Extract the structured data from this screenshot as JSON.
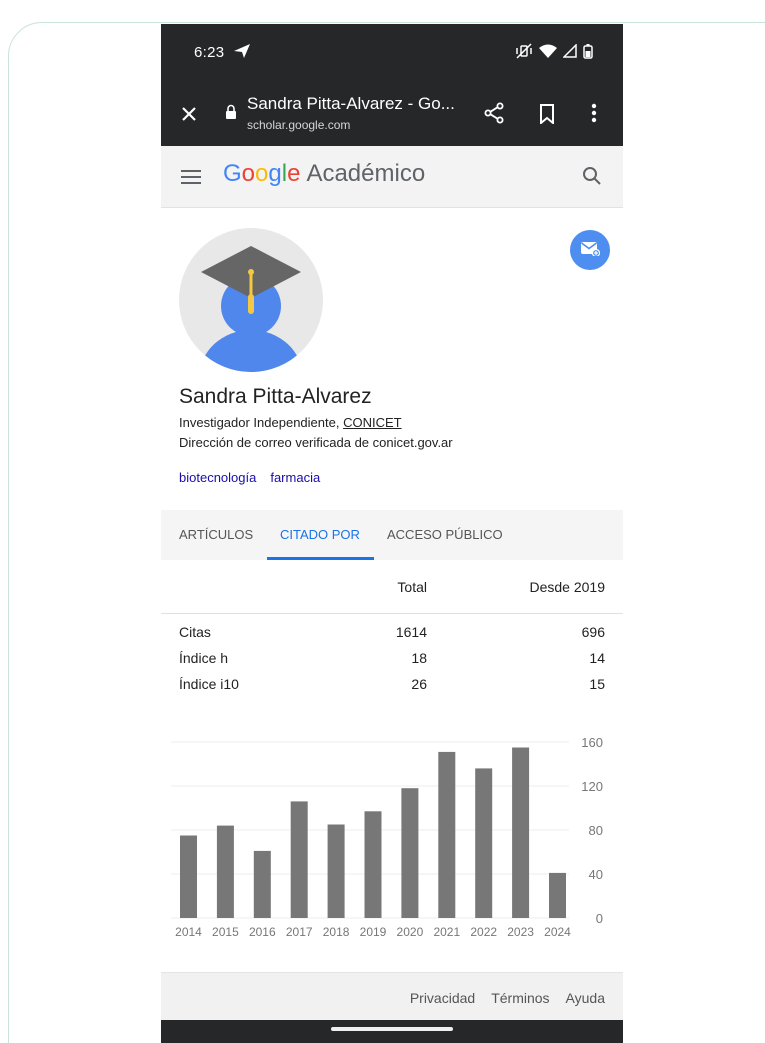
{
  "status_bar": {
    "time": "6:23"
  },
  "browser": {
    "page_title": "Sandra Pitta-Alvarez - Go...",
    "url": "scholar.google.com"
  },
  "app": {
    "brand_letters": [
      "G",
      "o",
      "o",
      "g",
      "l",
      "e"
    ],
    "brand_suffix": "Académico"
  },
  "profile": {
    "name": "Sandra Pitta-Alvarez",
    "position": "Investigador Independiente, ",
    "affiliation": "CONICET",
    "verified_email": "Dirección de correo verificada de conicet.gov.ar",
    "interests": [
      "biotecnología",
      "farmacia"
    ]
  },
  "tabs": [
    {
      "label": "ARTÍCULOS",
      "active": false
    },
    {
      "label": "CITADO POR",
      "active": true
    },
    {
      "label": "ACCESO PÚBLICO",
      "active": false
    }
  ],
  "stats": {
    "col_total": "Total",
    "col_since": "Desde 2019",
    "rows": [
      {
        "label": "Citas",
        "total": "1614",
        "since": "696"
      },
      {
        "label": "Índice h",
        "total": "18",
        "since": "14"
      },
      {
        "label": "Índice i10",
        "total": "26",
        "since": "15"
      }
    ]
  },
  "chart_data": {
    "type": "bar",
    "categories": [
      "2014",
      "2015",
      "2016",
      "2017",
      "2018",
      "2019",
      "2020",
      "2021",
      "2022",
      "2023",
      "2024"
    ],
    "values": [
      75,
      84,
      61,
      106,
      85,
      97,
      118,
      151,
      136,
      155,
      41
    ],
    "ylim": [
      0,
      160
    ],
    "yticks": [
      0,
      40,
      80,
      120,
      160
    ],
    "bar_color": "#777777",
    "grid": true
  },
  "footer": {
    "links": [
      "Privacidad",
      "Términos",
      "Ayuda"
    ]
  },
  "colors": {
    "system_bar": "#262729",
    "accent": "#1a73e8",
    "mail_button": "#4d8ef0",
    "link": "#1a0dab"
  }
}
